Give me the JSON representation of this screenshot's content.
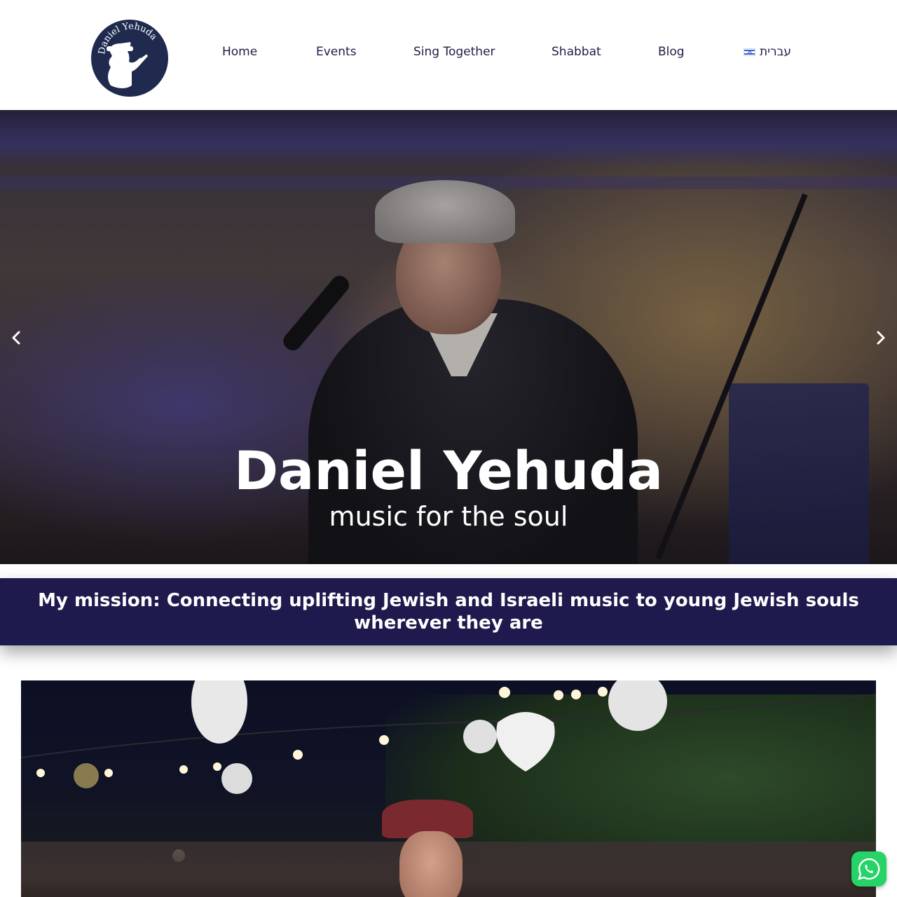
{
  "header": {
    "logo": {
      "name_text": "Daniel Yehuda",
      "tagline_text": "Music for the soul"
    },
    "nav": [
      {
        "label": "Home"
      },
      {
        "label": "Events"
      },
      {
        "label": "Sing Together"
      },
      {
        "label": "Shabbat"
      },
      {
        "label": "Blog"
      },
      {
        "label": "עברית",
        "icon": "israel-flag-icon"
      }
    ]
  },
  "hero": {
    "title": "Daniel Yehuda",
    "subtitle": "music for the soul",
    "prev_icon": "chevron-left-icon",
    "next_icon": "chevron-right-icon"
  },
  "mission": {
    "text": "My mission: Connecting uplifting Jewish and Israeli music to young Jewish souls wherever they are"
  },
  "floating": {
    "whatsapp_icon": "whatsapp-icon"
  },
  "colors": {
    "brand_navy": "#1f1a4d",
    "nav_text": "#1f1c47",
    "whatsapp_green": "#25d366"
  }
}
